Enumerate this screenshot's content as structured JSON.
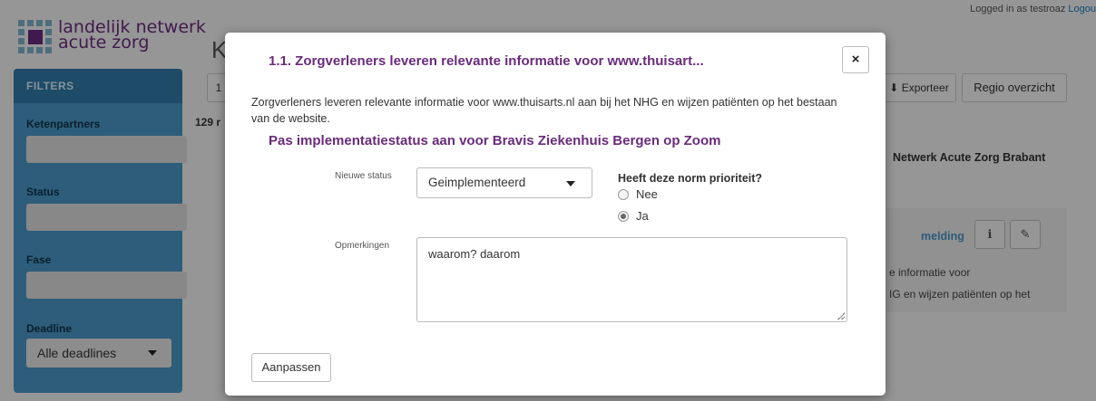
{
  "topbar": {
    "logged_in": "Logged in as testroaz",
    "logout": "Logou"
  },
  "logo": {
    "line1": "landelijk netwerk",
    "line2": "acute zorg"
  },
  "sidebar": {
    "title": "FILTERS",
    "ketenpartners_label": "Ketenpartners",
    "status_label": "Status",
    "fase_label": "Fase",
    "deadline_label": "Deadline",
    "deadline_value": "Alle deadlines"
  },
  "background": {
    "heading": "K",
    "count": "129 r",
    "left_btn": "1",
    "exporteer_label": "Exporteer",
    "regio_label": "Regio overzicht",
    "right_title": "Netwerk Acute Zorg Brabant",
    "melding_label": "melding",
    "text_line1": "e informatie voor",
    "text_line2": "IG en wijzen patiënten op het"
  },
  "modal": {
    "title": "1.1. Zorgverleners leveren relevante informatie voor www.thuisart...",
    "close_label": "×",
    "description": "Zorgverleners leveren relevante informatie voor www.thuisarts.nl aan bij het NHG en wijzen patiënten op het bestaan van de website.",
    "subheading": "Pas implementatiestatus aan voor Bravis Ziekenhuis Bergen op Zoom",
    "status_label": "Nieuwe status",
    "status_value": "Geimplementeerd",
    "priority_question": "Heeft deze norm prioriteit?",
    "option_no": "Nee",
    "option_yes": "Ja",
    "selected_priority": "Ja",
    "remarks_label": "Opmerkingen",
    "remarks_value": "waarom? daarom",
    "submit_label": "Aanpassen"
  },
  "colors": {
    "brand_purple": "#6a2b7c",
    "sidebar_blue": "#4a97c5"
  }
}
